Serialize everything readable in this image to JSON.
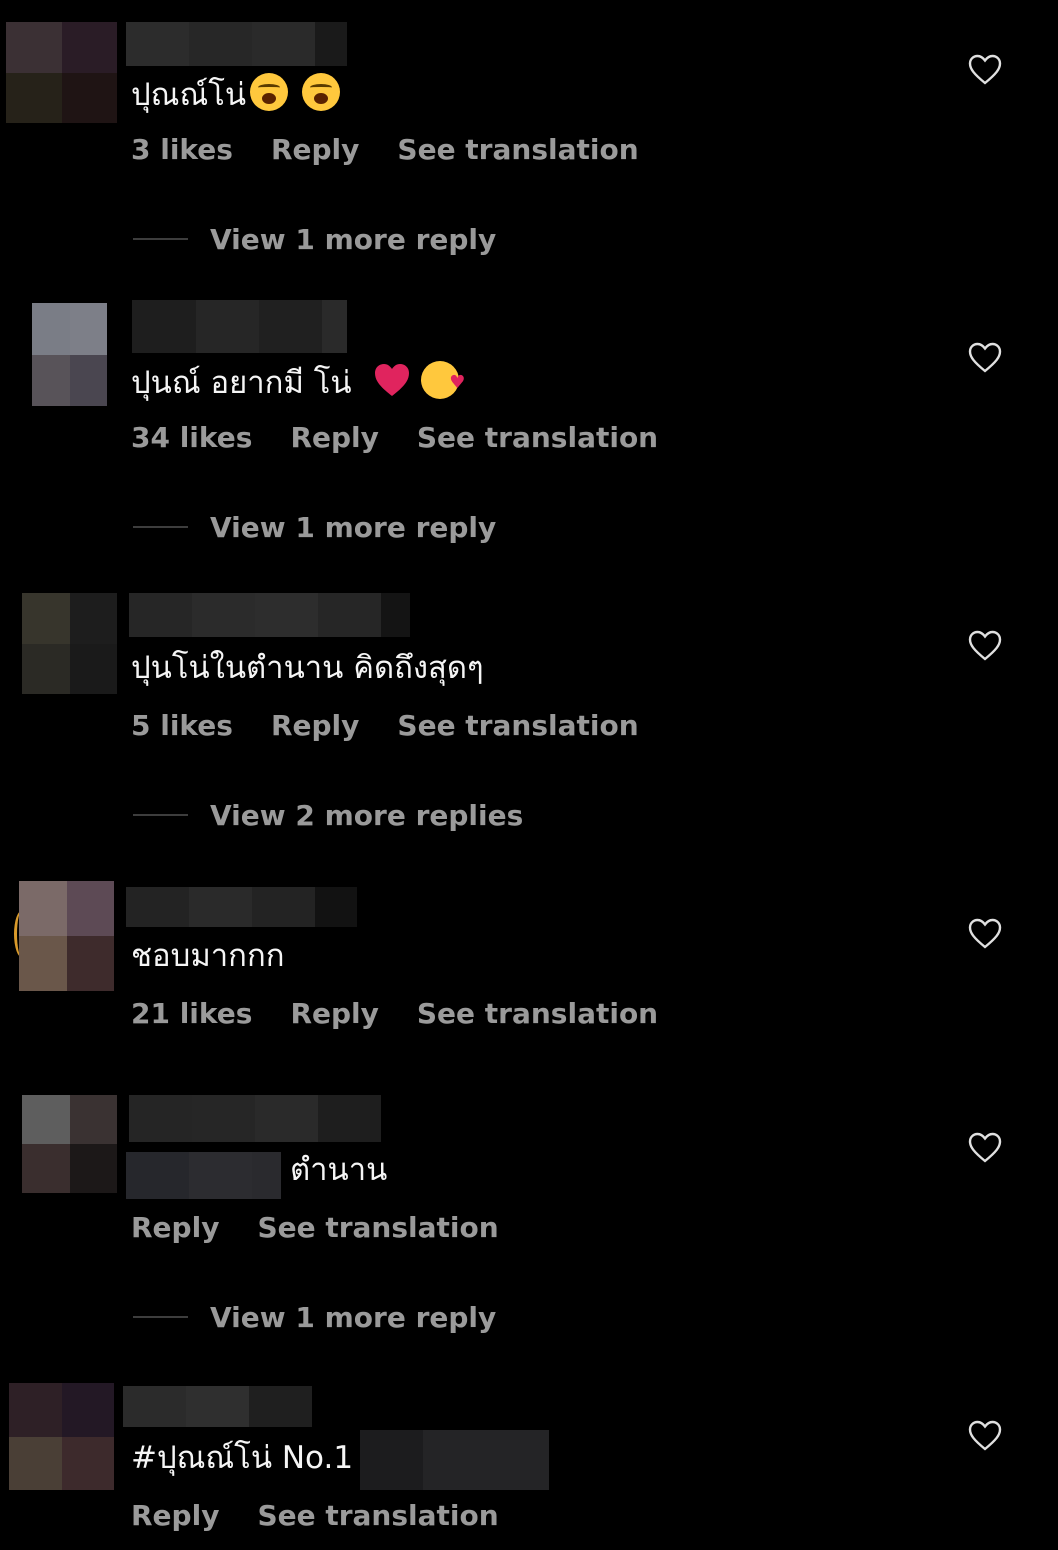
{
  "comments": [
    {
      "text": "ปุณณ์โน่",
      "emojis": [
        "loudly-crying-face-icon",
        "loudly-crying-face-icon"
      ],
      "likes": "3 likes",
      "reply": "Reply",
      "translate": "See translation",
      "more": "View 1 more reply"
    },
    {
      "text": "ปุนณ์ อยากมี โน่",
      "emojis": [
        "red-heart-icon",
        "smiling-face-with-hearts-icon"
      ],
      "likes": "34 likes",
      "reply": "Reply",
      "translate": "See translation",
      "more": "View 1 more reply"
    },
    {
      "text": "ปุนโน่ในตำนาน คิดถึงสุดๆ",
      "likes": "5 likes",
      "reply": "Reply",
      "translate": "See translation",
      "more": "View 2 more replies"
    },
    {
      "text": "ชอบมากกก",
      "likes": "21 likes",
      "reply": "Reply",
      "translate": "See translation"
    },
    {
      "text": "ตำนาน",
      "reply": "Reply",
      "translate": "See translation",
      "more": "View 1 more reply"
    },
    {
      "text": "#ปุณณ์โน่ No.1",
      "reply": "Reply",
      "translate": "See translation"
    }
  ],
  "icons": {
    "like": "heart-outline-icon"
  },
  "colors": {
    "background": "#000000",
    "text": "#f5f5f5",
    "muted": "#9a9a9a",
    "heart_emoji": "#e0245e"
  }
}
